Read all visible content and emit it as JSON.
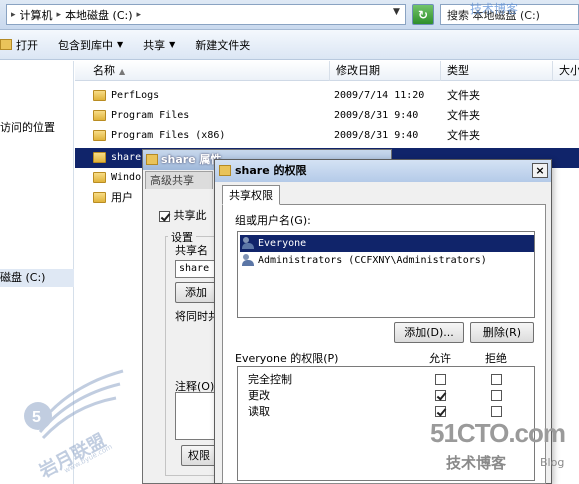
{
  "address": {
    "crumbs": [
      "计算机",
      "本地磁盘 (C:)"
    ],
    "refresh_symbol": "↻",
    "search_placeholder": "搜索 本地磁盘 (C:)",
    "blog_mark": "技术博客"
  },
  "commandbar": {
    "open": "打开",
    "include_library": "包含到库中",
    "share": "共享",
    "new_folder": "新建文件夹"
  },
  "navpane": {
    "recent_places": "访问的位置",
    "local_disk": "磁盘 (C:)"
  },
  "columns": {
    "name": "名称",
    "date": "修改日期",
    "type": "类型",
    "size": "大小"
  },
  "files": [
    {
      "name": "PerfLogs",
      "date": "2009/7/14 11:20",
      "type": "文件夹"
    },
    {
      "name": "Program Files",
      "date": "2009/8/31 9:40",
      "type": "文件夹"
    },
    {
      "name": "Program Files (x86)",
      "date": "2009/8/31 9:40",
      "type": "文件夹"
    },
    {
      "name": "share",
      "date": "",
      "type": ""
    },
    {
      "name": "Windo",
      "date": "",
      "type": ""
    },
    {
      "name": "用户",
      "date": "",
      "type": ""
    }
  ],
  "advanced_sharing": {
    "title": "share 属性",
    "tab": "高级共享",
    "share_checkbox": "共享此",
    "settings_group": "设置",
    "share_name_label": "共享名",
    "share_name_value": "share",
    "add_button": "添加",
    "limit_label": "将同时共",
    "comment_label": "注释(O)",
    "permissions_button": "权限"
  },
  "permissions": {
    "title": "share 的权限",
    "close_symbol": "×",
    "tab": "共享权限",
    "group_label": "组或用户名(G):",
    "users": [
      {
        "name": "Everyone",
        "selected": true
      },
      {
        "name": "Administrators (CCFXNY\\Administrators)",
        "selected": false
      }
    ],
    "add_button": "添加(D)...",
    "remove_button": "删除(R)",
    "for_label": "Everyone 的权限(P)",
    "allow_header": "允许",
    "deny_header": "拒绝",
    "rows": [
      {
        "name": "完全控制",
        "allow": false,
        "deny": false
      },
      {
        "name": "更改",
        "allow": true,
        "deny": false
      },
      {
        "name": "读取",
        "allow": true,
        "deny": false
      }
    ]
  },
  "watermark": {
    "site": "51CTO.com",
    "sub": "技术博客",
    "blog": "Blog",
    "left_text": "岩月联盟",
    "left_url": "www.byue.com"
  }
}
